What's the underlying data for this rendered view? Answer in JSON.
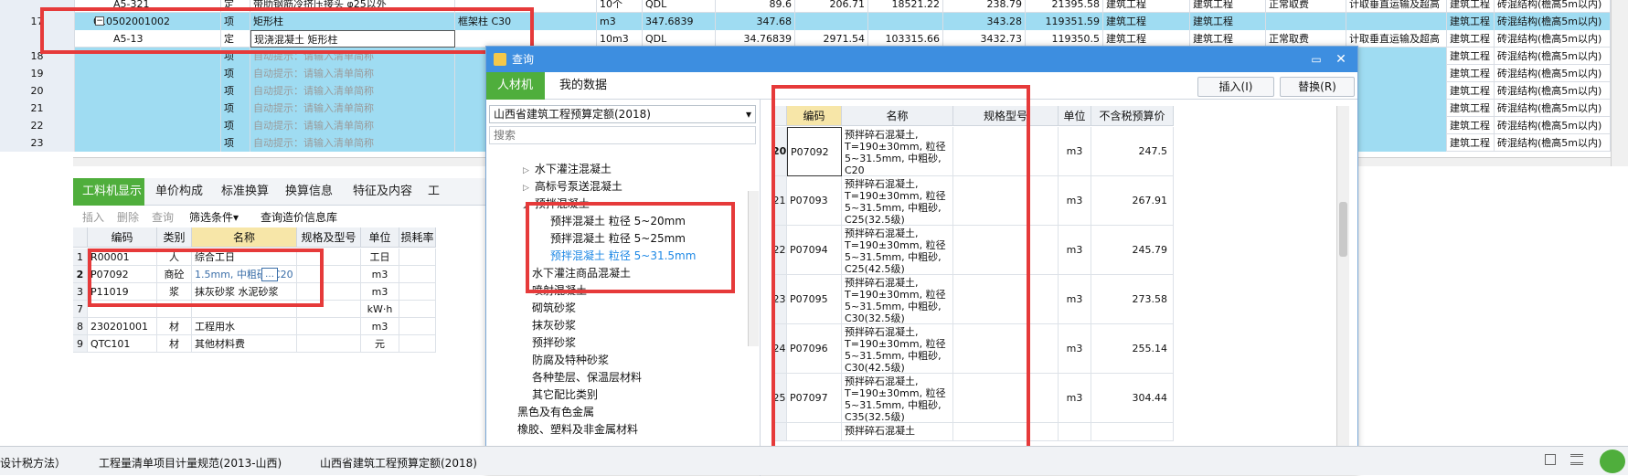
{
  "top_table": {
    "rows": [
      {
        "num": "",
        "code": "A5-321",
        "type": "定",
        "name": "带肋钢筋冷挤压接头 φ25以外",
        "feature": "",
        "unit": "10个",
        "expr": "QDL",
        "qty": "89.6",
        "price": "206.71",
        "total": "18521.22",
        "c1": "238.79",
        "c2": "21395.58",
        "c3": "建筑工程",
        "c4": "建筑工程",
        "c5": "正常取费",
        "c6": "计取垂直运输及超高",
        "c7": "建筑工程",
        "c8": "砖混结构(檐高5m以内)"
      },
      {
        "num": "17",
        "code": "010502001002",
        "type": "项",
        "name": "矩形柱",
        "feature": "框架柱 C30",
        "unit": "m3",
        "expr": "347.6839",
        "qty": "347.68",
        "price": "",
        "total": "",
        "c1": "343.28",
        "c2": "119351.59",
        "c3": "建筑工程",
        "c4": "建筑工程",
        "c5": "",
        "c6": "",
        "c7": "建筑工程",
        "c8": "砖混结构(檐高5m以内)"
      },
      {
        "num": "",
        "code": "A5-13",
        "type": "定",
        "name": "现浇混凝土 矩形柱",
        "feature": "",
        "unit": "10m3",
        "expr": "QDL",
        "qty": "34.76839",
        "price": "2971.54",
        "total": "103315.66",
        "c1": "3432.73",
        "c2": "119350.5",
        "c3": "建筑工程",
        "c4": "建筑工程",
        "c5": "正常取费",
        "c6": "计取垂直运输及超高",
        "c7": "建筑工程",
        "c8": "砖混结构(檐高5m以内)"
      },
      {
        "num": "18",
        "code": "",
        "type": "项",
        "name": "自动提示：请输入清单简称",
        "feature": "",
        "unit": "",
        "expr": "",
        "qty": "",
        "price": "",
        "total": "",
        "c1": "",
        "c2": "",
        "c3": "",
        "c4": "",
        "c5": "",
        "c6": "",
        "c7": "建筑工程",
        "c8": "砖混结构(檐高5m以内)"
      },
      {
        "num": "19",
        "code": "",
        "type": "项",
        "name": "自动提示：请输入清单简称",
        "feature": "",
        "unit": "",
        "expr": "",
        "qty": "",
        "price": "",
        "total": "",
        "c1": "",
        "c2": "",
        "c3": "",
        "c4": "",
        "c5": "",
        "c6": "",
        "c7": "建筑工程",
        "c8": "砖混结构(檐高5m以内)"
      },
      {
        "num": "20",
        "code": "",
        "type": "项",
        "name": "自动提示：请输入清单简称",
        "feature": "",
        "unit": "",
        "expr": "",
        "qty": "",
        "price": "",
        "total": "",
        "c1": "",
        "c2": "",
        "c3": "",
        "c4": "",
        "c5": "",
        "c6": "",
        "c7": "建筑工程",
        "c8": "砖混结构(檐高5m以内)"
      },
      {
        "num": "21",
        "code": "",
        "type": "项",
        "name": "自动提示：请输入清单简称",
        "feature": "",
        "unit": "",
        "expr": "",
        "qty": "",
        "price": "",
        "total": "",
        "c1": "",
        "c2": "",
        "c3": "",
        "c4": "",
        "c5": "",
        "c6": "",
        "c7": "建筑工程",
        "c8": "砖混结构(檐高5m以内)"
      },
      {
        "num": "22",
        "code": "",
        "type": "项",
        "name": "自动提示：请输入清单简称",
        "feature": "",
        "unit": "",
        "expr": "",
        "qty": "",
        "price": "",
        "total": "",
        "c1": "",
        "c2": "",
        "c3": "",
        "c4": "",
        "c5": "",
        "c6": "",
        "c7": "建筑工程",
        "c8": "砖混结构(檐高5m以内)"
      },
      {
        "num": "23",
        "code": "",
        "type": "项",
        "name": "自动提示：请输入清单简称",
        "feature": "",
        "unit": "",
        "expr": "",
        "qty": "",
        "price": "",
        "total": "",
        "c1": "",
        "c2": "",
        "c3": "",
        "c4": "",
        "c5": "",
        "c6": "",
        "c7": "建筑工程",
        "c8": "砖混结构(檐高5m以内)"
      }
    ]
  },
  "lower_tabs": [
    "工料机显示",
    "单价构成",
    "标准换算",
    "换算信息",
    "特征及内容",
    "工"
  ],
  "lower_toolbar": {
    "insert": "插入",
    "delete": "删除",
    "query": "查询",
    "filter": "筛选条件",
    "filter_arrow": "▾",
    "price_lib": "查询造价信息库"
  },
  "lower_table": {
    "headers": [
      "编码",
      "类别",
      "名称",
      "规格及型号",
      "单位",
      "损耗率"
    ],
    "rows": [
      {
        "num": "1",
        "code": "R00001",
        "cat": "人",
        "name": "综合工日",
        "spec": "",
        "unit": "工日"
      },
      {
        "num": "2",
        "code": "P07092",
        "cat": "商砼",
        "name": "1.5mm, 中粗砂, C20",
        "spec": "",
        "unit": "m3"
      },
      {
        "num": "3",
        "code": "P11019",
        "cat": "浆",
        "name": "抹灰砂浆 水泥砂浆",
        "spec": "",
        "unit": "m3"
      },
      {
        "num": "7",
        "code": "",
        "cat": "",
        "name": "",
        "spec": "",
        "unit": "kW·h"
      },
      {
        "num": "8",
        "code": "230201001",
        "cat": "材",
        "name": "工程用水",
        "spec": "",
        "unit": "m3"
      },
      {
        "num": "9",
        "code": "QTC101",
        "cat": "材",
        "name": "其他材料费",
        "spec": "",
        "unit": "元"
      }
    ],
    "more_button": "…"
  },
  "status_bar": {
    "item1": "设计税方法）",
    "item2": "工程量清单项目计量规范(2013-山西)",
    "item3": "山西省建筑工程预算定额(2018)"
  },
  "dialog": {
    "title": "查询",
    "tabs": [
      "人材机",
      "我的数据"
    ],
    "insert_button": "插入(I)",
    "replace_button": "替换(R)",
    "library_select": "山西省建筑工程预算定额(2018)",
    "search_placeholder": "搜索",
    "tree": [
      {
        "label": "水下灌注混凝土",
        "expander": "▷"
      },
      {
        "label": "高标号泵送混凝土",
        "expander": "▷"
      },
      {
        "label": "预拌混凝土",
        "expander": "◢"
      },
      {
        "label": "预拌混凝土 粒径 5~20mm",
        "expander": ""
      },
      {
        "label": "预拌混凝土 粒径 5~25mm",
        "expander": ""
      },
      {
        "label": "预拌混凝土 粒径 5~31.5mm",
        "expander": ""
      },
      {
        "label": "水下灌注商品混凝土",
        "expander": ""
      },
      {
        "label": "喷射混凝土",
        "expander": ""
      },
      {
        "label": "砌筑砂浆",
        "expander": ""
      },
      {
        "label": "抹灰砂浆",
        "expander": ""
      },
      {
        "label": "预拌砂浆",
        "expander": ""
      },
      {
        "label": "防腐及特种砂浆",
        "expander": ""
      },
      {
        "label": "各种垫层、保温层材料",
        "expander": ""
      },
      {
        "label": "其它配比类别",
        "expander": ""
      },
      {
        "label": "黑色及有色金属",
        "expander": ""
      },
      {
        "label": "橡胶、塑料及非金属材料",
        "expander": ""
      }
    ],
    "grid_headers": [
      "编码",
      "名称",
      "规格型号",
      "单位",
      "不含税预算价"
    ],
    "grid_rows": [
      {
        "num": "20",
        "code": "P07092",
        "name": "预拌碎石混凝土, T=190±30mm, 粒径5~31.5mm, 中粗砂, C20",
        "unit": "m3",
        "price": "247.5"
      },
      {
        "num": "21",
        "code": "P07093",
        "name": "预拌碎石混凝土, T=190±30mm, 粒径5~31.5mm, 中粗砂, C25(32.5级)",
        "unit": "m3",
        "price": "267.91"
      },
      {
        "num": "22",
        "code": "P07094",
        "name": "预拌碎石混凝土, T=190±30mm, 粒径5~31.5mm, 中粗砂, C25(42.5级)",
        "unit": "m3",
        "price": "245.79"
      },
      {
        "num": "23",
        "code": "P07095",
        "name": "预拌碎石混凝土, T=190±30mm, 粒径5~31.5mm, 中粗砂, C30(32.5级)",
        "unit": "m3",
        "price": "273.58"
      },
      {
        "num": "24",
        "code": "P07096",
        "name": "预拌碎石混凝土, T=190±30mm, 粒径5~31.5mm, 中粗砂, C30(42.5级)",
        "unit": "m3",
        "price": "255.14"
      },
      {
        "num": "25",
        "code": "P07097",
        "name": "预拌碎石混凝土, T=190±30mm, 粒径5~31.5mm, 中粗砂, C35(32.5级)",
        "unit": "m3",
        "price": "304.44"
      },
      {
        "num": "",
        "code": "",
        "name": "预拌碎石混凝土",
        "unit": "",
        "price": ""
      }
    ]
  },
  "colors": {
    "accent_green": "#4fae3c",
    "highlight_cyan": "#9fdcf2",
    "dialog_blue": "#3d8ee0",
    "annotation_red": "#e63a3a"
  }
}
